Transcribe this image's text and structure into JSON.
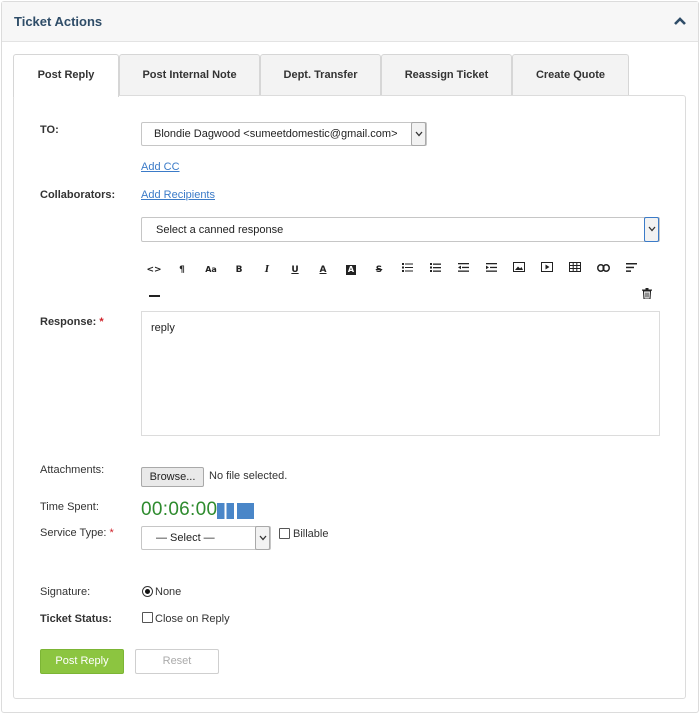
{
  "panel": {
    "title": "Ticket Actions"
  },
  "tabs": [
    {
      "label": "Post Reply",
      "active": true
    },
    {
      "label": "Post Internal Note",
      "active": false
    },
    {
      "label": "Dept. Transfer",
      "active": false
    },
    {
      "label": "Reassign Ticket",
      "active": false
    },
    {
      "label": "Create Quote",
      "active": false
    }
  ],
  "form": {
    "to_label": "TO:",
    "to_value": "Blondie Dagwood <sumeetdomestic@gmail.com>",
    "add_cc_label": "Add CC",
    "collaborators_label": "Collaborators:",
    "add_recipients_label": "Add Recipients",
    "canned_response_value": "Select a canned response",
    "response_label": "Response:",
    "required_mark": "*",
    "response_value": "reply",
    "attachments_label": "Attachments:",
    "browse_label": "Browse...",
    "no_file_text": "No file selected.",
    "time_spent_label": "Time Spent:",
    "timer_value": "00:06:00",
    "service_type_label": "Service Type:",
    "service_type_value": "— Select —",
    "billable_label": "Billable",
    "billable_checked": false,
    "signature_label": "Signature:",
    "signature_value": "None",
    "ticket_status_label": "Ticket Status:",
    "close_on_reply_label": "Close on Reply",
    "close_on_reply_checked": false,
    "post_reply_button": "Post Reply",
    "reset_button": "Reset"
  },
  "toolbar_icons": [
    "code-view-icon",
    "paragraph-icon",
    "font-size-icon",
    "bold-icon",
    "italic-icon",
    "underline-icon",
    "font-color-icon",
    "background-color-icon",
    "strikethrough-icon",
    "unordered-list-icon",
    "ordered-list-icon",
    "outdent-icon",
    "indent-icon",
    "image-icon",
    "video-icon",
    "table-icon",
    "link-icon",
    "align-icon",
    "horizontal-rule-icon",
    "trash-icon"
  ],
  "colors": {
    "title": "#2f4d68",
    "link": "#3b7bc8",
    "required": "#d0232b",
    "timer": "#2e8b2e",
    "timer_buttons": "#4a86c8",
    "post_button": "#8cc540"
  }
}
